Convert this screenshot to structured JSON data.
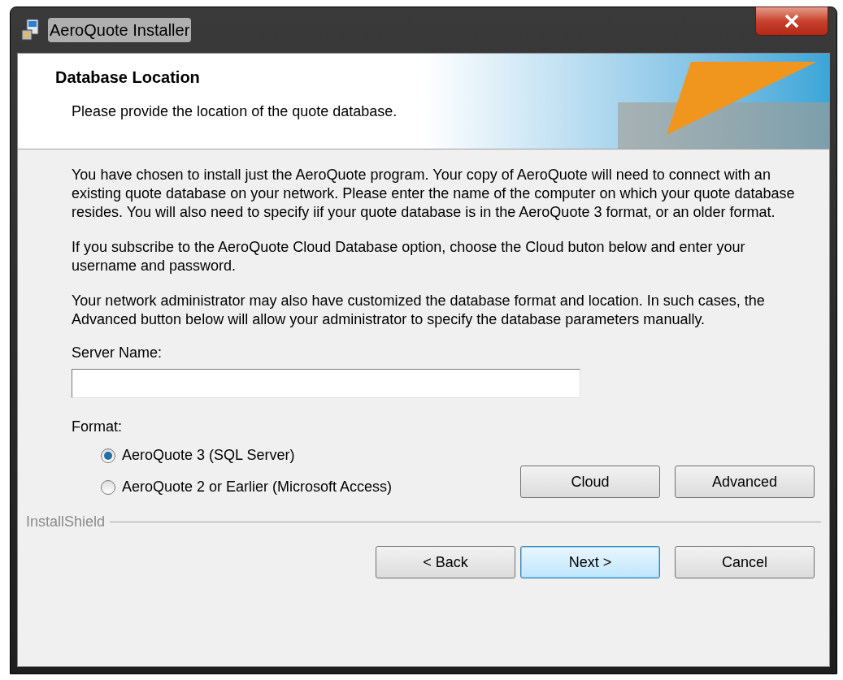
{
  "window": {
    "title": "AeroQuote Installer"
  },
  "header": {
    "title": "Database Location",
    "subtitle": "Please provide the location of the quote database."
  },
  "paragraphs": [
    "You have chosen to install just the AeroQuote program. Your copy of AeroQuote will need to connect with an existing quote database on your network. Please enter the name of the computer on which your quote database resides. You will also need to specify iif your quote database is in the AeroQuote 3 format, or an older format.",
    "If you subscribe to the AeroQuote Cloud Database option, choose the Cloud buton below and enter your username and password.",
    "Your network administrator may also have customized the database format and location.  In such cases, the Advanced button below will allow your administrator to specify the database parameters manually."
  ],
  "server_name": {
    "label": "Server Name:"
  },
  "format": {
    "label": "Format:",
    "options": [
      {
        "label": "AeroQuote 3 (SQL Server)",
        "selected": true
      },
      {
        "label": "AeroQuote 2 or Earlier (Microsoft Access)",
        "selected": false
      }
    ]
  },
  "side_buttons": [
    {
      "label": "Cloud"
    },
    {
      "label": "Advanced"
    }
  ],
  "brand": "InstallShield",
  "nav_buttons": [
    {
      "label": "< Back",
      "default": false
    },
    {
      "label": "Next >",
      "default": true
    },
    {
      "label": "Cancel",
      "default": false
    }
  ]
}
